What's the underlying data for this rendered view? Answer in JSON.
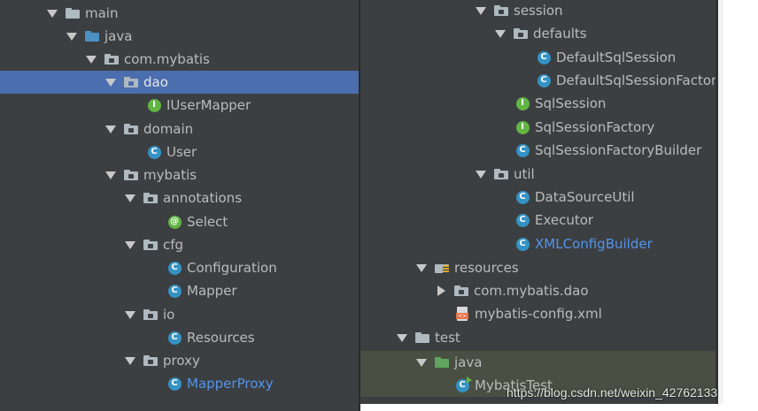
{
  "left_tree": [
    {
      "label": "main",
      "icon": "folder-icon",
      "arrow": "down",
      "selected": false
    },
    {
      "label": "java",
      "icon": "source-folder-icon",
      "arrow": "down"
    },
    {
      "label": "com.mybatis",
      "icon": "package-icon",
      "arrow": "down"
    },
    {
      "label": "dao",
      "icon": "package-icon",
      "arrow": "down",
      "selected": true
    },
    {
      "label": "IUserMapper",
      "icon": "interface-icon"
    },
    {
      "label": "domain",
      "icon": "package-icon",
      "arrow": "down"
    },
    {
      "label": "User",
      "icon": "class-icon"
    },
    {
      "label": "mybatis",
      "icon": "package-icon",
      "arrow": "down"
    },
    {
      "label": "annotations",
      "icon": "package-icon",
      "arrow": "down"
    },
    {
      "label": "Select",
      "icon": "annotation-icon"
    },
    {
      "label": "cfg",
      "icon": "package-icon",
      "arrow": "down"
    },
    {
      "label": "Configuration",
      "icon": "class-icon"
    },
    {
      "label": "Mapper",
      "icon": "class-icon"
    },
    {
      "label": "io",
      "icon": "package-icon",
      "arrow": "down"
    },
    {
      "label": "Resources",
      "icon": "class-icon"
    },
    {
      "label": "proxy",
      "icon": "package-icon",
      "arrow": "down"
    },
    {
      "label": "MapperProxy",
      "icon": "class-icon"
    }
  ],
  "right_tree": [
    {
      "label": "session",
      "icon": "package-icon",
      "arrow": "down"
    },
    {
      "label": "defaults",
      "icon": "package-icon",
      "arrow": "down"
    },
    {
      "label": "DefaultSqlSession",
      "icon": "class-icon"
    },
    {
      "label": "DefaultSqlSessionFactory",
      "icon": "class-icon"
    },
    {
      "label": "SqlSession",
      "icon": "interface-icon"
    },
    {
      "label": "SqlSessionFactory",
      "icon": "interface-icon"
    },
    {
      "label": "SqlSessionFactoryBuilder",
      "icon": "class-icon"
    },
    {
      "label": "util",
      "icon": "package-icon",
      "arrow": "down"
    },
    {
      "label": "DataSourceUtil",
      "icon": "class-icon"
    },
    {
      "label": "Executor",
      "icon": "class-icon"
    },
    {
      "label": "XMLConfigBuilder",
      "icon": "class-icon"
    },
    {
      "label": "resources",
      "icon": "resources-folder-icon",
      "arrow": "down"
    },
    {
      "label": "com.mybatis.dao",
      "icon": "package-icon",
      "arrow": "right"
    },
    {
      "label": "mybatis-config.xml",
      "icon": "xml-file-icon"
    },
    {
      "label": "test",
      "icon": "folder-icon",
      "arrow": "down"
    },
    {
      "label": "java",
      "icon": "test-folder-icon",
      "arrow": "down"
    },
    {
      "label": "MybatisTest",
      "icon": "test-class-icon"
    }
  ],
  "watermark": "https://blog.csdn.net/weixin_42762133",
  "colors": {
    "panel_bg": "#3c3f41",
    "selection": "#4b6eaf",
    "class_icon": "#3592c4",
    "interface_icon": "#62b543",
    "link_text": "#5394ec"
  }
}
